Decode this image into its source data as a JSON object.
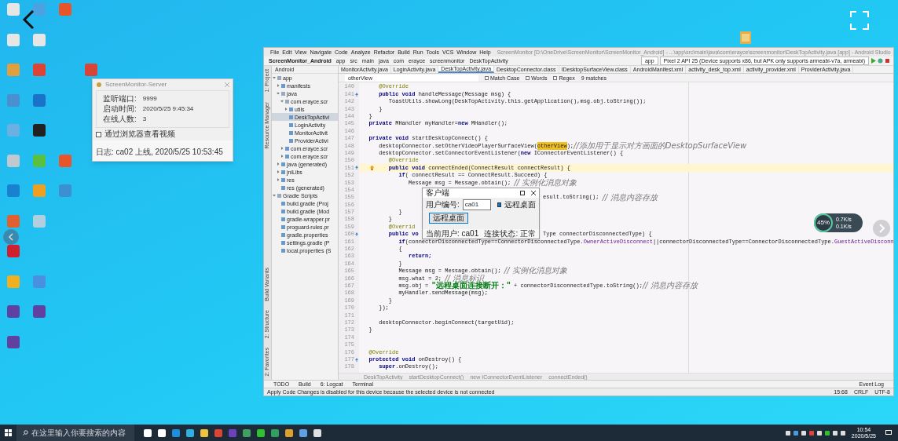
{
  "desktop_icons": [
    {
      "kind": "icon",
      "color": "#e6e6e6"
    },
    {
      "kind": "icon",
      "color": "#4aa3e0"
    },
    {
      "kind": "icon",
      "color": "#e8552b"
    },
    {
      "kind": "blank"
    },
    {
      "kind": "icon",
      "color": "#e6e6e6"
    },
    {
      "kind": "icon",
      "color": "#e6e6e6"
    },
    {
      "kind": "blank"
    },
    {
      "kind": "blank"
    },
    {
      "kind": "icon",
      "color": "#e0a040"
    },
    {
      "kind": "icon",
      "color": "#dd4433"
    },
    {
      "kind": "blank"
    },
    {
      "kind": "icon",
      "color": "#d64535"
    },
    {
      "kind": "icon",
      "color": "#4a90d0"
    },
    {
      "kind": "icon",
      "color": "#1a73c8"
    },
    {
      "kind": "blank"
    },
    {
      "kind": "blank"
    },
    {
      "kind": "icon",
      "color": "#6ab0e0"
    },
    {
      "kind": "icon",
      "color": "#222222"
    },
    {
      "kind": "blank"
    },
    {
      "kind": "blank"
    },
    {
      "kind": "icon",
      "color": "#c0c8d0"
    },
    {
      "kind": "icon",
      "color": "#5ac040"
    },
    {
      "kind": "icon",
      "color": "#e8552b"
    },
    {
      "kind": "blank"
    },
    {
      "kind": "icon",
      "color": "#1a80d0"
    },
    {
      "kind": "icon",
      "color": "#f0a020"
    },
    {
      "kind": "icon",
      "color": "#3a90d0"
    },
    {
      "kind": "blank"
    },
    {
      "kind": "icon",
      "color": "#e06030"
    },
    {
      "kind": "icon",
      "color": "#b0d0e0"
    },
    {
      "kind": "blank"
    },
    {
      "kind": "blank"
    },
    {
      "kind": "icon",
      "color": "#d02030"
    },
    {
      "kind": "blank"
    },
    {
      "kind": "blank"
    },
    {
      "kind": "blank"
    },
    {
      "kind": "icon",
      "color": "#f0b020"
    },
    {
      "kind": "icon",
      "color": "#4a90e0"
    },
    {
      "kind": "blank"
    },
    {
      "kind": "blank"
    },
    {
      "kind": "icon",
      "color": "#6040a0"
    },
    {
      "kind": "icon",
      "color": "#6040a0"
    },
    {
      "kind": "blank"
    },
    {
      "kind": "blank"
    },
    {
      "kind": "icon",
      "color": "#6040a0"
    },
    {
      "kind": "blank"
    },
    {
      "kind": "blank"
    },
    {
      "kind": "blank"
    }
  ],
  "server_window": {
    "title": "ScreenMonitor-Server",
    "rows": [
      {
        "label": "监听端口:",
        "value": "9999"
      },
      {
        "label": "启动时间:",
        "value": "2020/5/25 9:45:34"
      },
      {
        "label": "在线人数:",
        "value": "3"
      }
    ],
    "checkbox": {
      "label": "通过浏览器查看视频",
      "checked": false
    },
    "log": "日志:  ca02 上线, 2020/5/25 10:53:45"
  },
  "ide": {
    "menu": [
      "File",
      "Edit",
      "View",
      "Navigate",
      "Code",
      "Analyze",
      "Refactor",
      "Build",
      "Run",
      "Tools",
      "VCS",
      "Window",
      "Help"
    ],
    "title": "ScreenMonitor [D:\\OneDrive\\ScreenMonitor\\ScreenMonitor_Android] - ...\\app\\src\\main\\java\\com\\erayce\\screenmonitor\\DeskTopActivity.java [app] - Android Studio",
    "breadcrumbs": [
      "ScreenMonitor_Android",
      "app",
      "src",
      "main",
      "java",
      "com",
      "erayce",
      "screenmonitor",
      "DeskTopActivity"
    ],
    "run_config": "app",
    "device": "Pixel 2 API 25 (Device supports x86, but APK only supports armeabi-v7a, armeabi)",
    "project_header": "Android",
    "tabs": [
      {
        "label": "MonitorActivity.java",
        "selected": false
      },
      {
        "label": "LoginActivity.java",
        "selected": false
      },
      {
        "label": "DeskTopActivity.java",
        "selected": true
      },
      {
        "label": "DesktopConnector.class",
        "selected": false
      },
      {
        "label": "IDesktopSurfaceView.class",
        "selected": false
      },
      {
        "label": "AndroidManifest.xml",
        "selected": false
      },
      {
        "label": "activity_desk_top.xml",
        "selected": false
      },
      {
        "label": "activity_provider.xml",
        "selected": false
      },
      {
        "label": "ProviderActivity.java",
        "selected": false
      }
    ],
    "search": {
      "value": "otherView",
      "options": [
        {
          "label": "Match Case",
          "checked": false
        },
        {
          "label": "Words",
          "checked": false
        },
        {
          "label": "Regex",
          "checked": false
        }
      ],
      "result": "9 matches"
    },
    "side_tabs_left": [
      "1: Project",
      "Resource Manager"
    ],
    "side_tabs_bottom": [
      "Build Variants",
      "2: Structure",
      "2: Favorites"
    ],
    "tree": [
      {
        "label": "app",
        "expanded": true,
        "selected": false,
        "children": [
          {
            "label": "manifests",
            "expanded": false,
            "selected": false
          },
          {
            "label": "java",
            "expanded": true,
            "selected": false,
            "children": [
              {
                "label": "com.erayce.scr",
                "expanded": true,
                "selected": false,
                "children": [
                  {
                    "label": "utils",
                    "expanded": false,
                    "selected": false
                  },
                  {
                    "label": "DeskTopActivi",
                    "selected": true
                  },
                  {
                    "label": "LoginActivity",
                    "selected": false
                  },
                  {
                    "label": "MonitorActivit",
                    "selected": false
                  },
                  {
                    "label": "ProviderActivi",
                    "selected": false
                  }
                ]
              },
              {
                "label": "com.erayce.scr",
                "expanded": false,
                "selected": false
              },
              {
                "label": "com.erayce.scr",
                "expanded": false,
                "selected": false
              }
            ]
          },
          {
            "label": "java (generated)",
            "expanded": false,
            "selected": false
          },
          {
            "label": "jniLibs",
            "expanded": false,
            "selected": false
          },
          {
            "label": "res",
            "expanded": false,
            "selected": false
          },
          {
            "label": "res (generated)",
            "selected": false
          }
        ]
      },
      {
        "label": "Gradle Scripts",
        "expanded": true,
        "selected": false,
        "children": [
          {
            "label": "build.gradle (Proj",
            "selected": false
          },
          {
            "label": "build.gradle (Mod",
            "selected": false
          },
          {
            "label": "gradle-wrapper.pr",
            "selected": false
          },
          {
            "label": "proguard-rules.pr",
            "selected": false
          },
          {
            "label": "gradle.properties",
            "selected": false
          },
          {
            "label": "settings.gradle (P",
            "selected": false
          },
          {
            "label": "local.properties (S",
            "selected": false
          }
        ]
      }
    ],
    "code": [
      {
        "num": "140",
        "segs": [
          {
            "kind": "annotation",
            "text": "      @Override"
          }
        ]
      },
      {
        "num": "141",
        "override": true,
        "segs": [
          {
            "kind": "keyword",
            "text": "      public void "
          },
          {
            "kind": "code",
            "text": "handleMessage(Message msg) {"
          }
        ]
      },
      {
        "num": "142",
        "segs": [
          {
            "kind": "code",
            "text": "         ToastUtils.showLong(DeskTopActivity.this.getApplication(),msg.obj.toString());"
          }
        ]
      },
      {
        "num": "143",
        "segs": [
          {
            "kind": "code",
            "text": "      }"
          }
        ]
      },
      {
        "num": "144",
        "segs": [
          {
            "kind": "code",
            "text": "   }"
          }
        ]
      },
      {
        "num": "145",
        "segs": [
          {
            "kind": "keyword",
            "text": "   private "
          },
          {
            "kind": "code",
            "text": "MHandler myHandler="
          },
          {
            "kind": "keyword",
            "text": "new "
          },
          {
            "kind": "code",
            "text": "MHandler();"
          }
        ]
      },
      {
        "num": "146"
      },
      {
        "num": "147",
        "segs": [
          {
            "kind": "keyword",
            "text": "   private void "
          },
          {
            "kind": "code",
            "text": "startDesktopConnect() {"
          }
        ]
      },
      {
        "num": "148",
        "segs": [
          {
            "kind": "code",
            "text": "      desktopConnector.setOtherVideoPlayerSurfaceView("
          },
          {
            "kind": "match",
            "text": "otherView"
          },
          {
            "kind": "code",
            "text": ");"
          },
          {
            "kind": "comment",
            "text": "//添加用于显示对方画面的DesktopSurfaceView"
          }
        ]
      },
      {
        "num": "149",
        "segs": [
          {
            "kind": "code",
            "text": "      desktopConnector.setConnectorEventListener("
          },
          {
            "kind": "keyword",
            "text": "new "
          },
          {
            "kind": "code",
            "text": "IConnectorEventListener() {"
          }
        ]
      },
      {
        "num": "150",
        "segs": [
          {
            "kind": "annotation",
            "text": "         @Override"
          }
        ]
      },
      {
        "num": "151",
        "override": true,
        "bulb": true,
        "current": true,
        "segs": [
          {
            "kind": "keyword",
            "text": "         public void "
          },
          {
            "kind": "code",
            "text": "connectEnded(ConnectResult connectResult) {"
          }
        ]
      },
      {
        "num": "152",
        "segs": [
          {
            "kind": "keyword",
            "text": "            if"
          },
          {
            "kind": "code",
            "text": "( connectResult == ConnectResult.Succeed) {"
          }
        ]
      },
      {
        "num": "153",
        "segs": [
          {
            "kind": "code",
            "text": "               Message msg = Message.obtain(); "
          },
          {
            "kind": "comment",
            "text": "// 实例化消息对象"
          }
        ]
      },
      {
        "num": "154"
      },
      {
        "num": "155",
        "segs": [
          {
            "kind": "covered"
          },
          {
            "kind": "code",
            "text": "esult.toString(); "
          },
          {
            "kind": "comment",
            "text": "// 消息内容存放"
          }
        ]
      },
      {
        "num": "156"
      },
      {
        "num": "157",
        "segs": [
          {
            "kind": "code",
            "text": "            }"
          }
        ]
      },
      {
        "num": "158",
        "segs": [
          {
            "kind": "code",
            "text": "         }"
          }
        ]
      },
      {
        "num": "159",
        "segs": [
          {
            "kind": "annotation",
            "text": "         @Overrid"
          }
        ]
      },
      {
        "num": "160",
        "override": true,
        "segs": [
          {
            "kind": "keyword",
            "text": "         public vo"
          },
          {
            "kind": "covered"
          },
          {
            "kind": "code",
            "text": "Type connectorDisconnectedType) {"
          }
        ]
      },
      {
        "num": "161",
        "segs": [
          {
            "kind": "keyword",
            "text": "            if"
          },
          {
            "kind": "code",
            "text": "(connectorDisconnectedType==ConnectorDisconnectedType."
          },
          {
            "kind": "field",
            "text": "OwnerActiveDisconnect"
          },
          {
            "kind": "code",
            "text": "||connectorDisconnectedType==ConnectorDisconnectedType."
          },
          {
            "kind": "field",
            "text": "GuestActiveDisconn"
          }
        ]
      },
      {
        "num": "162",
        "segs": [
          {
            "kind": "code",
            "text": "            {"
          }
        ]
      },
      {
        "num": "163",
        "segs": [
          {
            "kind": "keyword",
            "text": "               return;"
          }
        ]
      },
      {
        "num": "164",
        "segs": [
          {
            "kind": "code",
            "text": "            }"
          }
        ]
      },
      {
        "num": "165",
        "segs": [
          {
            "kind": "code",
            "text": "            Message msg = Message.obtain(); "
          },
          {
            "kind": "comment",
            "text": "// 实例化消息对象"
          }
        ]
      },
      {
        "num": "166",
        "segs": [
          {
            "kind": "code",
            "text": "            msg.what = 2; "
          },
          {
            "kind": "comment",
            "text": "// 消息标识"
          }
        ]
      },
      {
        "num": "167",
        "segs": [
          {
            "kind": "code",
            "text": "            msg.obj = "
          },
          {
            "kind": "string",
            "text": "\"远程桌面连接断开：\""
          },
          {
            "kind": "code",
            "text": " + connectorDisconnectedType.toString();"
          },
          {
            "kind": "comment",
            "text": "// 消息内容存放"
          }
        ]
      },
      {
        "num": "168",
        "segs": [
          {
            "kind": "code",
            "text": "            myHandler.sendMessage(msg);"
          }
        ]
      },
      {
        "num": "169",
        "segs": [
          {
            "kind": "code",
            "text": "         }"
          }
        ]
      },
      {
        "num": "170",
        "segs": [
          {
            "kind": "code",
            "text": "      });"
          }
        ]
      },
      {
        "num": "171"
      },
      {
        "num": "172",
        "segs": [
          {
            "kind": "code",
            "text": "      desktopConnector.beginConnect(targetUid);"
          }
        ]
      },
      {
        "num": "173",
        "segs": [
          {
            "kind": "code",
            "text": "   }"
          }
        ]
      },
      {
        "num": "174"
      },
      {
        "num": "175"
      },
      {
        "num": "176",
        "segs": [
          {
            "kind": "annotation",
            "text": "   @Override"
          }
        ]
      },
      {
        "num": "177",
        "override": true,
        "segs": [
          {
            "kind": "keyword",
            "text": "   protected void "
          },
          {
            "kind": "code",
            "text": "onDestroy() {"
          }
        ]
      },
      {
        "num": "178",
        "segs": [
          {
            "kind": "keyword",
            "text": "      super"
          },
          {
            "kind": "code",
            "text": ".onDestroy();"
          }
        ]
      }
    ],
    "code_breadcrumb": [
      "DeskTopActivity",
      "startDesktopConnect()",
      "new IConnectorEventListener",
      "connectEnded()"
    ],
    "tool_tabs": [
      "TODO",
      "Build",
      "6: Logcat",
      "Terminal"
    ],
    "event_log": "Event Log",
    "status": "Apply Code Changes is disabled for this device because the selected device is not connected",
    "status_right": [
      "15:68",
      "CRLF",
      "UTF-8"
    ]
  },
  "client_dialog": {
    "title": "客户端",
    "field_label": "用户编号:",
    "field_value": "ca01",
    "checkbox": {
      "label": "远程桌面",
      "checked": true
    },
    "button": "远程桌面",
    "status_left": "当前用户: ca01",
    "status_right": "连接状态: 正常"
  },
  "net_widget": {
    "percent": "45%",
    "up": "0.7K/s",
    "down": "0.1K/s"
  },
  "taskbar": {
    "search_placeholder": "在这里输入你要搜索的内容",
    "apps": [
      {
        "color": "#ffffff"
      },
      {
        "color": "#ffffff"
      },
      {
        "color": "#1a8fe0"
      },
      {
        "color": "#30b0e0"
      },
      {
        "color": "#f0c040"
      },
      {
        "color": "#dd4433"
      },
      {
        "color": "#7040c0"
      },
      {
        "color": "#40a060"
      },
      {
        "color": "#30c030"
      },
      {
        "color": "#30a060"
      },
      {
        "color": "#e0a030"
      },
      {
        "color": "#60a0e0"
      },
      {
        "color": "#e0e0e0"
      }
    ],
    "time": "10:54",
    "date": "2020/5/25"
  }
}
